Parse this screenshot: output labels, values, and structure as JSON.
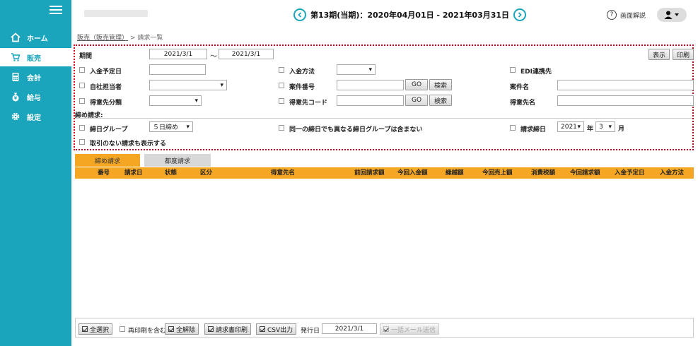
{
  "header": {
    "period": "第13期(当期)：2020年04月01日 - 2021年03月31日",
    "help_label": "画面解説"
  },
  "sidebar": {
    "items": [
      {
        "label": "ホーム"
      },
      {
        "label": "販売"
      },
      {
        "label": "会計"
      },
      {
        "label": "給与"
      },
      {
        "label": "設定"
      }
    ]
  },
  "breadcrumb": {
    "parent": "販売（販売管理）",
    "separator": ">",
    "current": "請求一覧"
  },
  "filter": {
    "period_label": "期間",
    "date_from": "2021/3/1",
    "tilde": "〜",
    "date_to": "2021/3/1",
    "show_button": "表示",
    "print_button": "印刷",
    "payment_due_label": "入金予定日",
    "payment_method_label": "入金方法",
    "edi_label": "EDI連携先",
    "staff_label": "自社担当者",
    "case_no_label": "案件番号",
    "case_name_label": "案件名",
    "go_label": "GO",
    "search_label": "検索",
    "customer_class_label": "得意先分類",
    "customer_code_label": "得意先コード",
    "customer_name_label": "得意先名",
    "closing_section_label": "締め請求:",
    "closing_group_label": "締日グループ",
    "closing_group_value": "５日締め",
    "exclude_same_label": "同一の締日でも異なる締日グループは含まない",
    "billing_date_label": "請求締日",
    "year_value": "2021",
    "year_unit": "年",
    "month_value": "3",
    "month_unit": "月",
    "show_no_tx_label": "取引のない請求も表示する"
  },
  "tabs": [
    {
      "label": "締め請求"
    },
    {
      "label": "都度請求"
    }
  ],
  "table": {
    "columns": [
      "番号",
      "請求日",
      "状態",
      "区分",
      "得意先名",
      "前回請求額",
      "今回入金額",
      "繰越額",
      "今回売上額",
      "消費税額",
      "今回請求額",
      "入金予定日",
      "入金方法"
    ]
  },
  "toolbar": {
    "select_all": "全選択",
    "include_reprint": "再印刷を含む",
    "deselect_all": "全解除",
    "print_invoice": "請求書印刷",
    "csv_output": "CSV出力",
    "issue_date_label": "発行日",
    "issue_date_value": "2021/3/1",
    "bulk_mail": "一括メール送信"
  },
  "colors": {
    "sidebar": "#1ba5bd",
    "accent": "#f5a623",
    "highlight_border": "#d0021b"
  }
}
